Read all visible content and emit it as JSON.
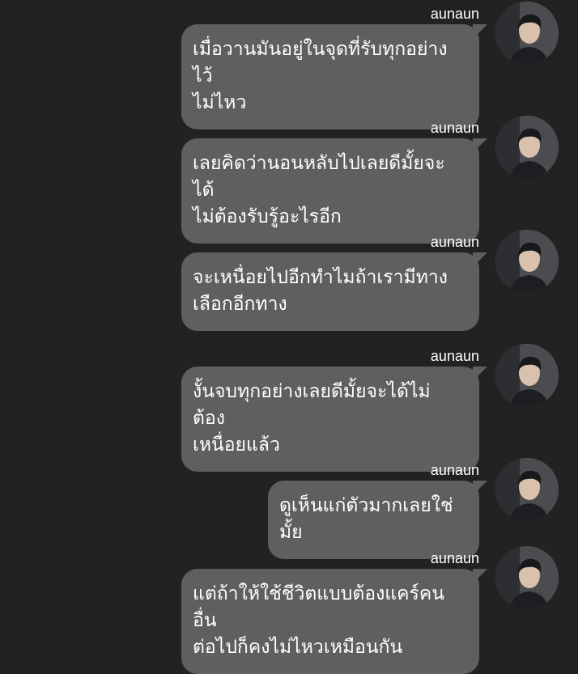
{
  "messages": [
    {
      "sender": "aunaun",
      "lines": [
        "เมื่อวานมันอยู่ในจุดที่รับทุกอย่างไว้",
        "ไม่ไหว"
      ]
    },
    {
      "sender": "aunaun",
      "lines": [
        "เลยคิดว่านอนหลับไปเลยดีมั้ยจะได้",
        "ไม่ต้องรับรู้อะไรอีก"
      ]
    },
    {
      "sender": "aunaun",
      "lines": [
        "จะเหนื่อยไปอีกทำไมถ้าเรามีทาง",
        "เลือกอีกทาง"
      ]
    },
    {
      "sender": "aunaun",
      "lines": [
        "งั้นจบทุกอย่างเลยดีมั้ยจะได้ไม่ต้อง",
        "เหนื่อยแล้ว"
      ]
    },
    {
      "sender": "aunaun",
      "lines": [
        "ดูเห็นแก่ตัวมากเลยใช่มั้ย"
      ]
    },
    {
      "sender": "aunaun",
      "lines": [
        "แต่ถ้าให้ใช้ชีวิตแบบต้องแคร์คนอื่น",
        "ต่อไปก็คงไม่ไหวเหมือนกัน"
      ]
    }
  ],
  "colors": {
    "background": "#222222",
    "bubble": "#5f5f5f",
    "text": "#ffffff"
  },
  "icons": {
    "avatar": "profile-photo-avatar"
  }
}
